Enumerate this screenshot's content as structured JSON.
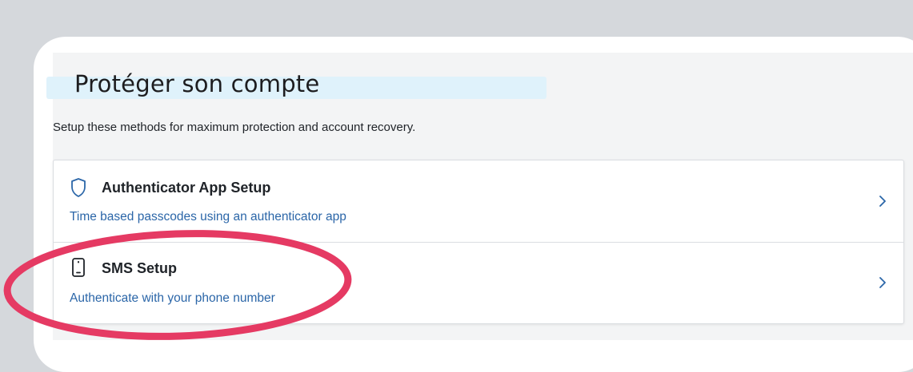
{
  "header": {
    "title": "Protéger son compte",
    "subtitle": "Setup these methods for maximum protection and account recovery."
  },
  "methods": [
    {
      "title": "Authenticator App Setup",
      "description": "Time based passcodes using an authenticator app",
      "icon": "shield-icon"
    },
    {
      "title": "SMS Setup",
      "description": "Authenticate with your phone number",
      "icon": "phone-icon"
    }
  ],
  "colors": {
    "accent_text": "#2b66a8",
    "annotation": "#e53a63",
    "title_highlight": "#dff2fb"
  }
}
